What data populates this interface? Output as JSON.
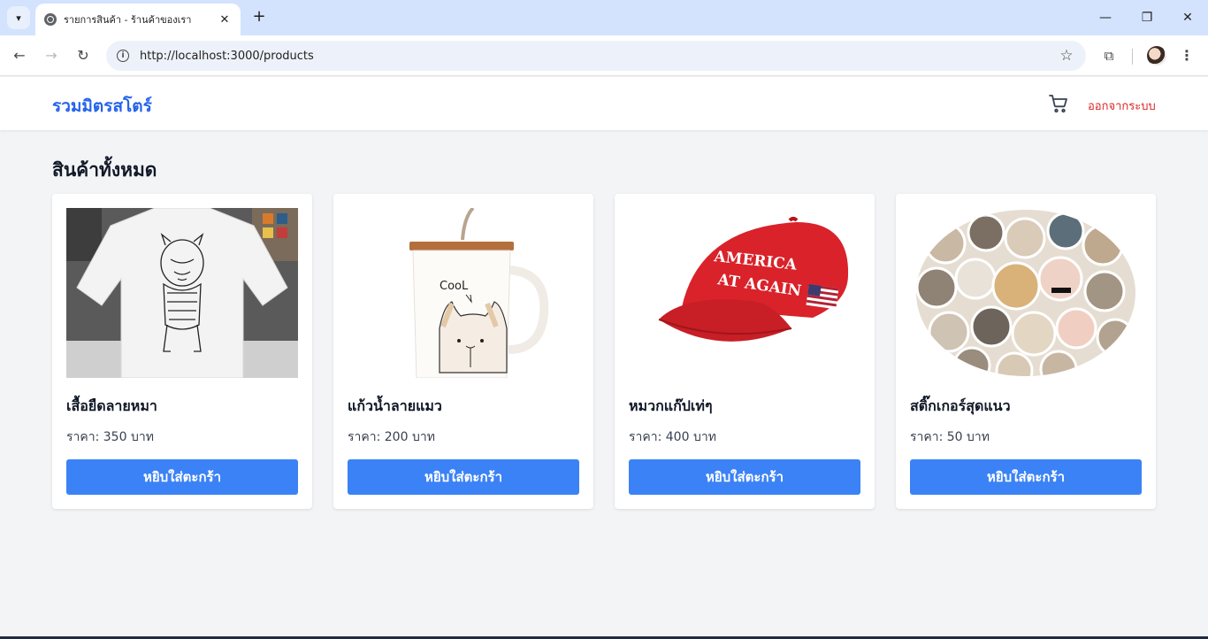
{
  "browser": {
    "tab_title": "รายการสินค้า - ร้านค้าของเรา",
    "url": "http://localhost:3000/products",
    "tab_close": "✕",
    "new_tab": "+",
    "minimize": "—",
    "restore": "❐",
    "close_window": "✕"
  },
  "header": {
    "brand": "รวมมิตรสโตร์",
    "logout_label": "ออกจากระบบ"
  },
  "page": {
    "title": "สินค้าทั้งหมด"
  },
  "products": [
    {
      "name": "เสื้อยืดลายหมา",
      "price": "ราคา: 350 บาท",
      "button": "หยิบใส่ตะกร้า"
    },
    {
      "name": "แก้วน้ำลายแมว",
      "price": "ราคา: 200 บาท",
      "button": "หยิบใส่ตะกร้า"
    },
    {
      "name": "หมวกแก๊ปเท่ๆ",
      "price": "ราคา: 400 บาท",
      "button": "หยิบใส่ตะกร้า"
    },
    {
      "name": "สติ๊กเกอร์สุดแนว",
      "price": "ราคา: 50 บาท",
      "button": "หยิบใส่ตะกร้า"
    }
  ],
  "hat_text": {
    "line1": "AMERICA",
    "line2": "AT AGAIN"
  },
  "mug_text": "CooL",
  "colors": {
    "brand": "#2563eb",
    "button": "#3b82f6",
    "logout": "#dc2626",
    "background": "#f3f4f6"
  }
}
